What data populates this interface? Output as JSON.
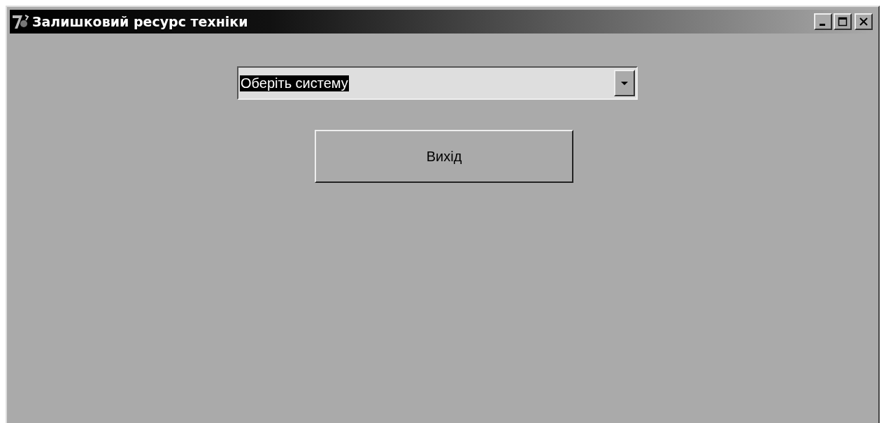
{
  "window": {
    "title": "Залишковий ресурс техніки"
  },
  "system_dropdown": {
    "value": "Оберіть систему",
    "text_selected": true
  },
  "buttons": [
    {
      "label": "Вихід"
    }
  ]
}
